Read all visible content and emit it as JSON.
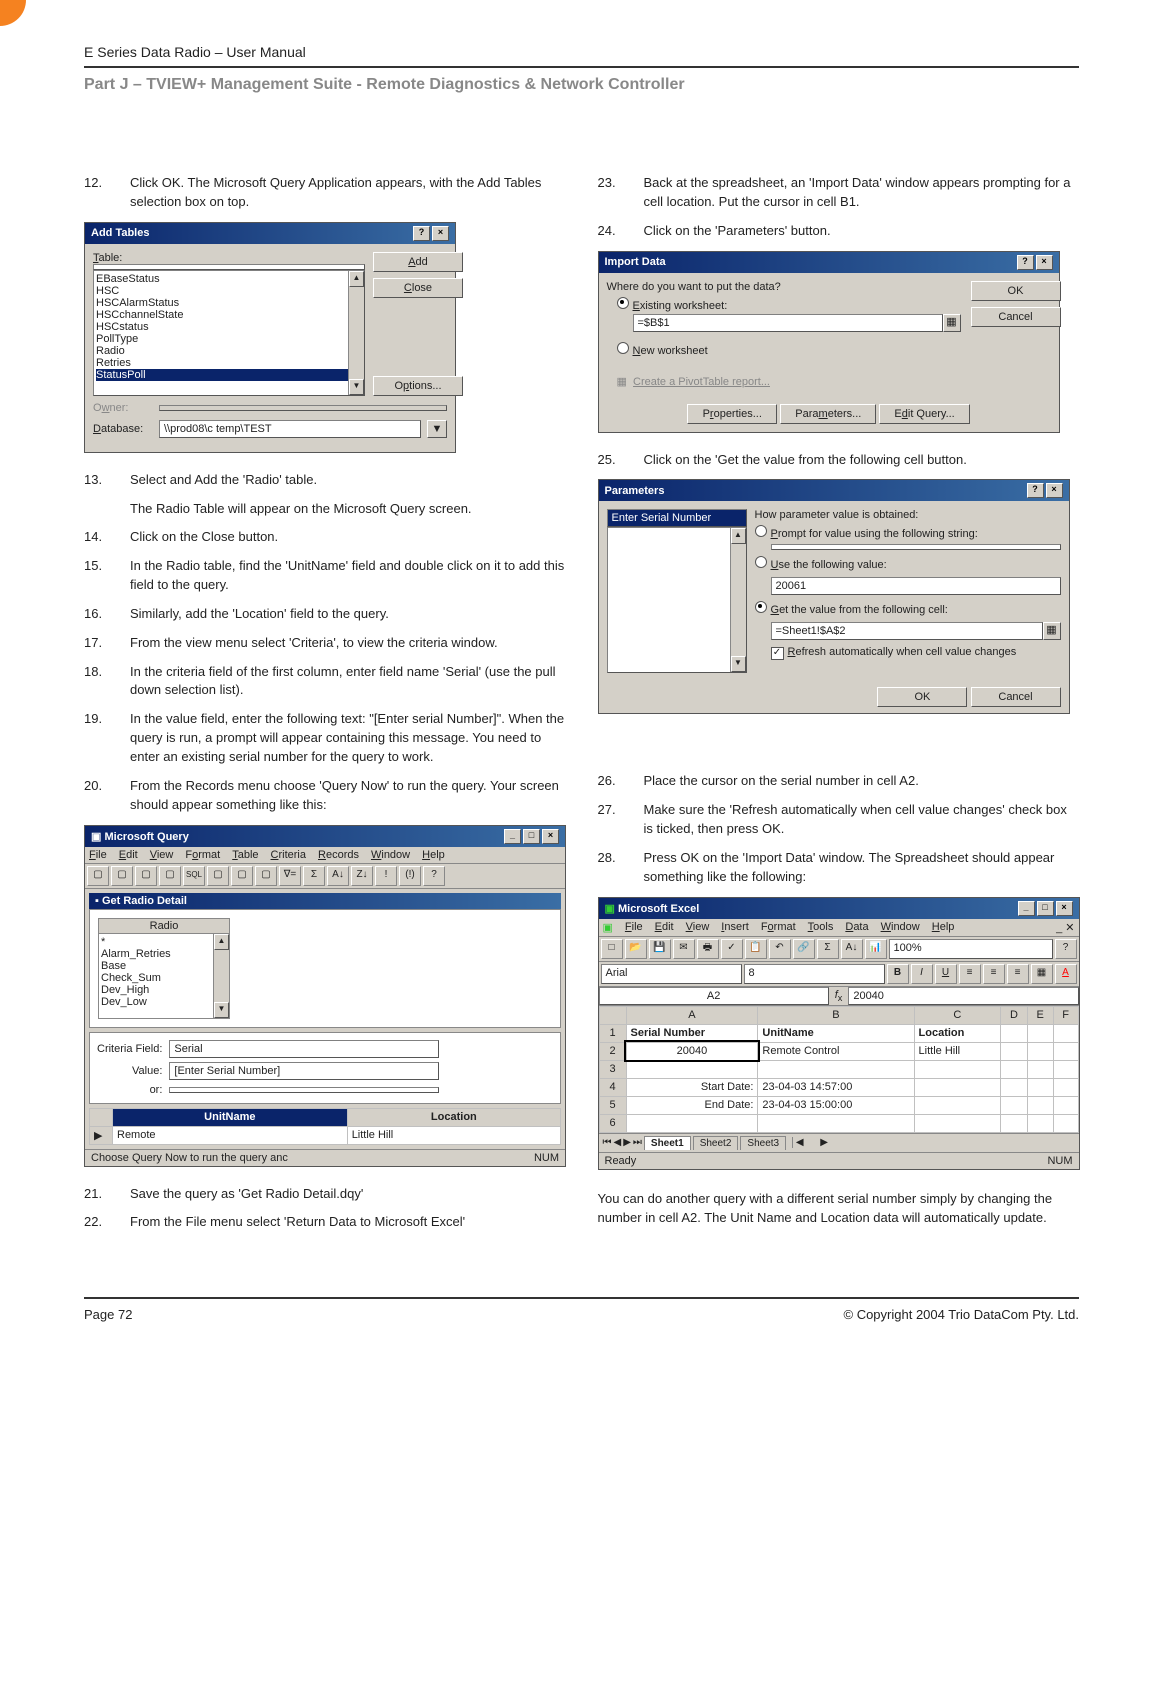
{
  "header": {
    "doc_title": "E Series Data Radio – User Manual",
    "section": "Part J – TVIEW+ Management Suite -  Remote Diagnostics & Network Controller"
  },
  "left": {
    "steps_a": [
      {
        "n": "12.",
        "t": "Click OK. The Microsoft Query Application appears, with the Add Tables selection box on top."
      }
    ],
    "add_tables": {
      "title": "Add Tables",
      "label_table": "Table:",
      "items": [
        "EBaseStatus",
        "HSC",
        "HSCAlarmStatus",
        "HSCchannelState",
        "HSCstatus",
        "PollType",
        "Radio",
        "Retries",
        "StatusPoll"
      ],
      "selected": "StatusPoll",
      "btn_add": "Add",
      "btn_close": "Close",
      "btn_options": "Options...",
      "label_owner": "Owner:",
      "label_db": "Database:",
      "db_value": "\\\\prod08\\c temp\\TEST"
    },
    "steps_b": [
      {
        "n": "13.",
        "t": "Select and Add the 'Radio' table."
      }
    ],
    "sub_13": "The Radio Table will appear on the Microsoft Query screen.",
    "steps_c": [
      {
        "n": "14.",
        "t": "Click on the Close button."
      },
      {
        "n": "15.",
        "t": "In the Radio table, find the 'UnitName' field and double click on it to add this field to the query."
      },
      {
        "n": "16.",
        "t": "Similarly, add the 'Location' field to the query."
      },
      {
        "n": "17.",
        "t": "From the view menu select 'Criteria', to view the criteria window."
      },
      {
        "n": "18.",
        "t": "In the criteria field of the first column, enter field name 'Serial' (use the pull down selection list)."
      },
      {
        "n": "19.",
        "t": "In the value field, enter the following text: \"[Enter serial Number]\". When the query is run, a prompt will appear containing this message. You need to enter an existing serial number for the query to work."
      },
      {
        "n": "20.",
        "t": "From the Records menu choose 'Query Now' to run the query. Your screen should appear something like this:"
      }
    ],
    "msquery": {
      "app_title": "Microsoft Query",
      "menus": [
        "File",
        "Edit",
        "View",
        "Format",
        "Table",
        "Criteria",
        "Records",
        "Window",
        "Help"
      ],
      "inner_title": "Get Radio Detail",
      "table_header": "Radio",
      "table_fields": [
        "*",
        "Alarm_Retries",
        "Base",
        "Check_Sum",
        "Dev_High",
        "Dev_Low"
      ],
      "crit_label_field": "Criteria Field:",
      "crit_label_value": "Value:",
      "crit_label_or": "or:",
      "crit_field_val": "Serial",
      "crit_value_val": "[Enter Serial Number]",
      "col1": "UnitName",
      "col2": "Location",
      "row1_c1": "Remote",
      "row1_c2": "Little Hill",
      "status_left": "Choose Query Now to run the query anc",
      "status_right": "NUM"
    },
    "steps_d": [
      {
        "n": "21.",
        "t": "Save the query as 'Get Radio Detail.dqy'"
      },
      {
        "n": "22.",
        "t": "From the File menu select 'Return Data to Microsoft Excel'"
      }
    ]
  },
  "right": {
    "steps_a": [
      {
        "n": "23.",
        "t": "Back at the spreadsheet, an 'Import Data' window appears prompting for a cell location. Put the cursor in cell B1."
      },
      {
        "n": "24.",
        "t": "Click on the 'Parameters' button."
      }
    ],
    "import_data": {
      "title": "Import Data",
      "prompt": "Where do you want to put the data?",
      "opt_existing": "Existing worksheet:",
      "existing_val": "=$B$1",
      "opt_new": "New worksheet",
      "pivot_link": "Create a PivotTable report...",
      "btn_ok": "OK",
      "btn_cancel": "Cancel",
      "btn_props": "Properties...",
      "btn_params": "Parameters...",
      "btn_edit": "Edit Query..."
    },
    "steps_b": [
      {
        "n": "25.",
        "t": "Click on the 'Get the value from the following cell button."
      }
    ],
    "parameters": {
      "title": "Parameters",
      "left_item": "Enter Serial Number",
      "heading": "How parameter value is obtained:",
      "opt1": "Prompt for value using the following string:",
      "opt2": "Use the following value:",
      "opt2_val": "20061",
      "opt3": "Get the value from the following cell:",
      "opt3_val": "=Sheet1!$A$2",
      "chk_refresh": "Refresh automatically when cell value changes",
      "btn_ok": "OK",
      "btn_cancel": "Cancel"
    },
    "steps_c": [
      {
        "n": "26.",
        "t": "Place the cursor on the serial number in cell A2."
      },
      {
        "n": "27.",
        "t": "Make sure the 'Refresh automatically when cell value changes' check box is ticked, then press OK."
      },
      {
        "n": "28.",
        "t": "Press OK on the 'Import Data' window. The Spreadsheet should appear something like the following:"
      }
    ],
    "excel": {
      "app_title": "Microsoft Excel",
      "menus": [
        "File",
        "Edit",
        "View",
        "Insert",
        "Format",
        "Tools",
        "Data",
        "Window",
        "Help"
      ],
      "font_name": "Arial",
      "font_size": "8",
      "zoom": "100%",
      "cell_ref": "A2",
      "fx_val": "20040",
      "cols": [
        "",
        "A",
        "B",
        "C",
        "D",
        "E",
        "F"
      ],
      "rows": [
        {
          "r": "1",
          "cells": [
            "Serial Number",
            "UnitName",
            "Location",
            "",
            "",
            ""
          ]
        },
        {
          "r": "2",
          "cells": [
            "20040",
            "Remote Control",
            "Little Hill",
            "",
            "",
            ""
          ]
        },
        {
          "r": "3",
          "cells": [
            "",
            "",
            "",
            "",
            "",
            ""
          ]
        },
        {
          "r": "4",
          "cells": [
            "Start Date:",
            "23-04-03 14:57:00",
            "",
            "",
            "",
            ""
          ]
        },
        {
          "r": "5",
          "cells": [
            "End Date:",
            "23-04-03 15:00:00",
            "",
            "",
            "",
            ""
          ]
        },
        {
          "r": "6",
          "cells": [
            "",
            "",
            "",
            "",
            "",
            ""
          ]
        }
      ],
      "sheets": [
        "Sheet1",
        "Sheet2",
        "Sheet3"
      ],
      "status_left": "Ready",
      "status_right": "NUM"
    },
    "closing": "You can do another query with a different serial number simply by changing the number in cell A2.  The Unit Name and Location data will automatically update."
  },
  "footer": {
    "page": "Page 72",
    "copyright": "© Copyright 2004 Trio DataCom Pty. Ltd."
  }
}
